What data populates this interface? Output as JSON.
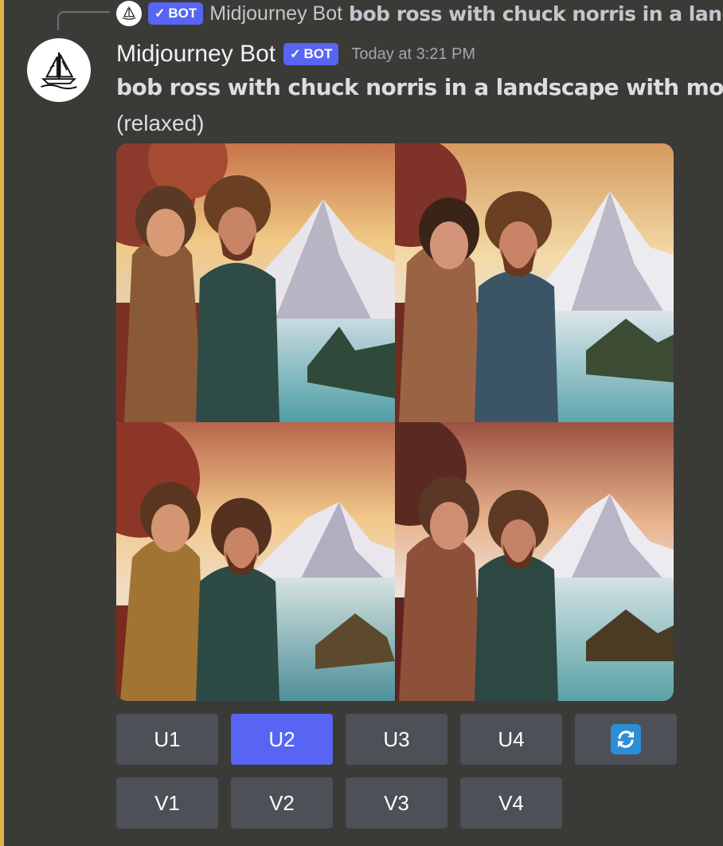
{
  "reply": {
    "author": "Midjourney Bot",
    "badge": "BOT",
    "content": "bob ross with chuck norris in a landscape with mountains"
  },
  "message": {
    "author": "Midjourney Bot",
    "badge": "BOT",
    "timestamp": "Today at 3:21 PM",
    "prompt": "bob ross with chuck norris in a landscape with mountains",
    "mode": "(relaxed)"
  },
  "image_grid": {
    "tiles": [
      "grid-image-1",
      "grid-image-2",
      "grid-image-3",
      "grid-image-4"
    ]
  },
  "buttons": {
    "row1": [
      {
        "label": "U1",
        "active": false
      },
      {
        "label": "U2",
        "active": true
      },
      {
        "label": "U3",
        "active": false
      },
      {
        "label": "U4",
        "active": false
      }
    ],
    "reroll_icon": "refresh-icon",
    "row2": [
      {
        "label": "V1"
      },
      {
        "label": "V2"
      },
      {
        "label": "V3"
      },
      {
        "label": "V4"
      }
    ]
  },
  "colors": {
    "background": "#3a3a37",
    "mention_bar": "#e0b14a",
    "bot_badge": "#5865f2",
    "button": "#4e5058",
    "button_active": "#5865f2",
    "timestamp": "#a3a6aa"
  }
}
